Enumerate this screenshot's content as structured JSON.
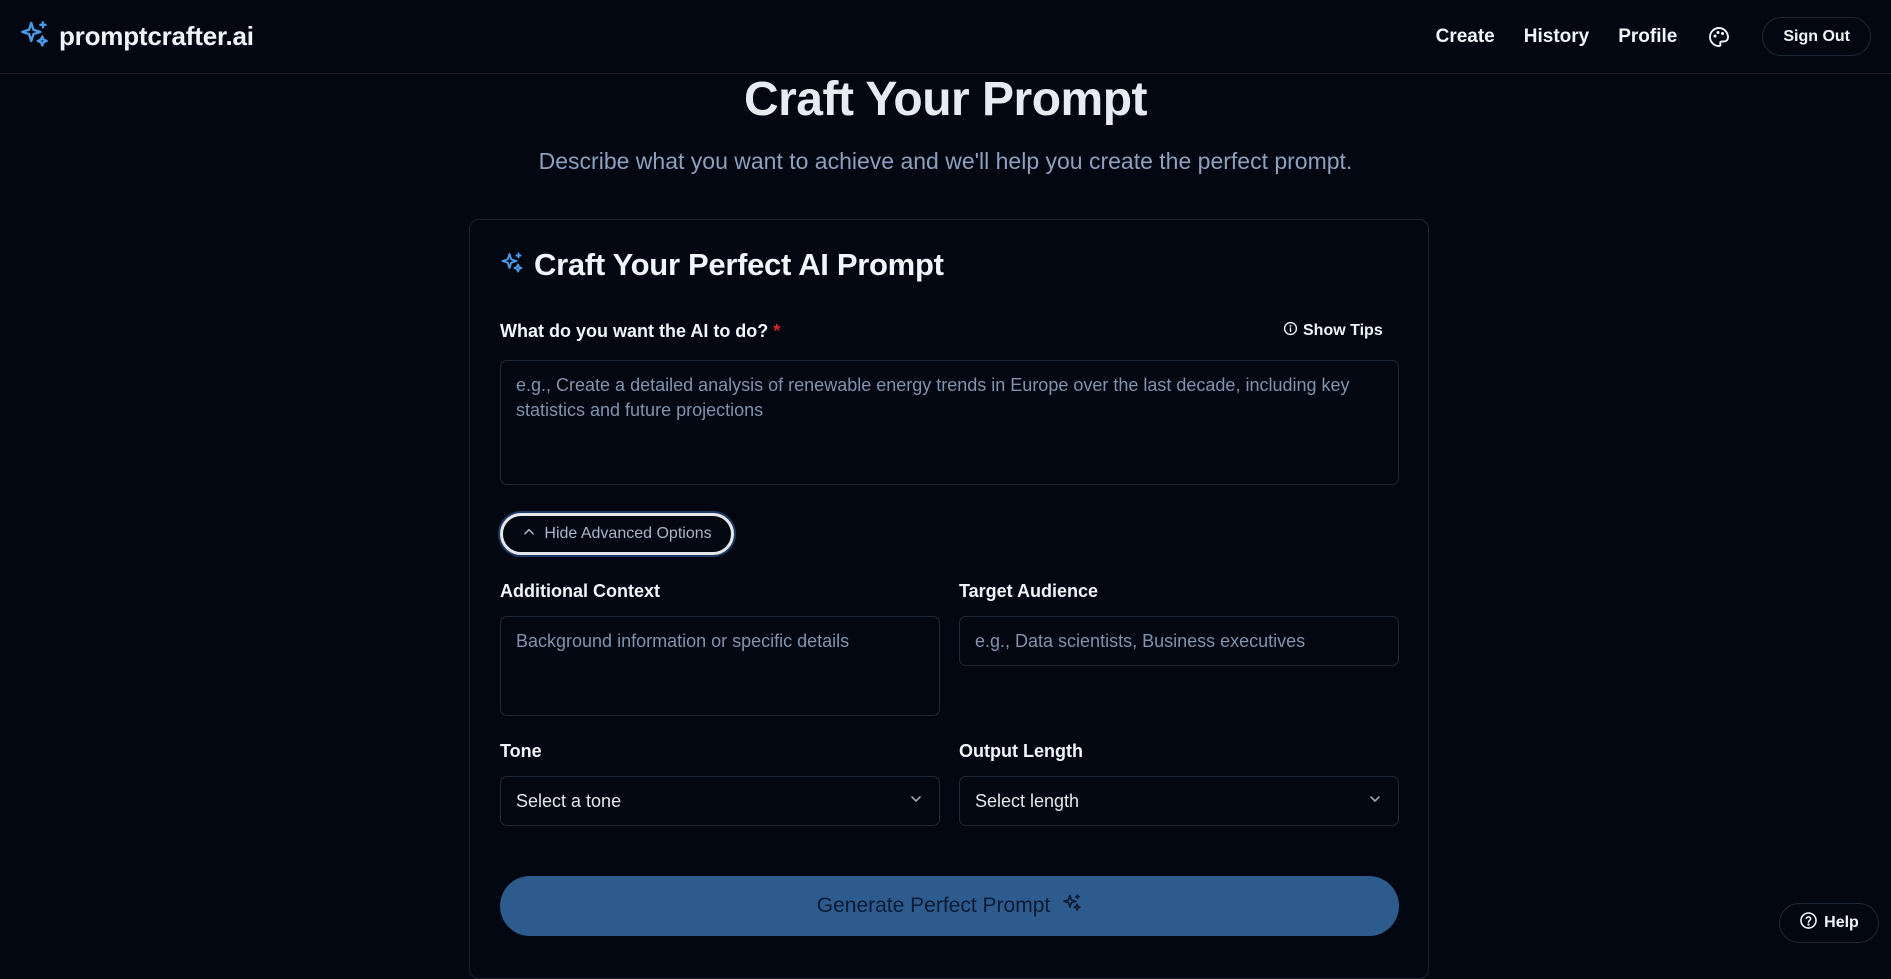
{
  "brand": {
    "name": "promptcrafter.ai",
    "icon": "sparkles-icon",
    "accent": "#4c9be8"
  },
  "nav": {
    "links": [
      "Create",
      "History",
      "Profile"
    ],
    "palette_icon": "palette-icon",
    "sign_out": "Sign Out"
  },
  "hero": {
    "title": "Craft Your Prompt",
    "subtitle": "Describe what you want to achieve and we'll help you create the perfect prompt."
  },
  "form": {
    "title": "Craft Your Perfect AI Prompt",
    "main_label": "What do you want the AI to do?",
    "required_mark": "*",
    "show_tips": "Show Tips",
    "main_placeholder": "e.g., Create a detailed analysis of renewable energy trends in Europe over the last decade, including key statistics and future projections",
    "advanced_toggle": "Hide Advanced Options",
    "context_label": "Additional Context",
    "context_placeholder": "Background information or specific details",
    "audience_label": "Target Audience",
    "audience_placeholder": "e.g., Data scientists, Business executives",
    "tone_label": "Tone",
    "tone_value": "Select a tone",
    "length_label": "Output Length",
    "length_value": "Select length",
    "submit": "Generate Perfect Prompt"
  },
  "help": {
    "label": "Help"
  },
  "colors": {
    "background": "#030712",
    "primary_button": "#2d5b8d",
    "required": "#dc2626"
  }
}
